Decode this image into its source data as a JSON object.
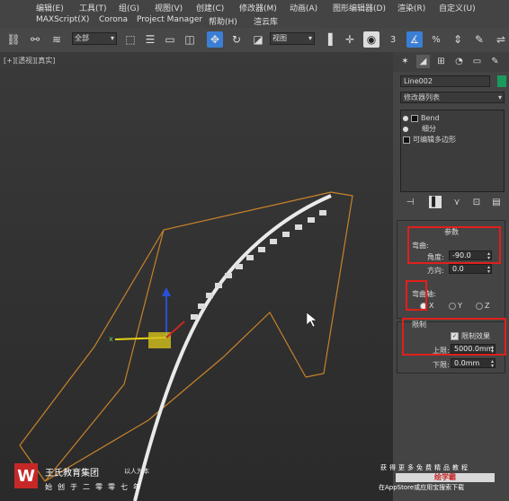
{
  "menubar": {
    "row1": [
      "编辑(E)",
      "工具(T)",
      "组(G)",
      "视图(V)",
      "创建(C)",
      "修改器(M)",
      "动画(A)",
      "图形编辑器(D)",
      "渲染(R)",
      "自定义(U)"
    ],
    "row2": [
      "MAXScript(X)",
      "Corona",
      "Project Manager",
      "帮助(H)",
      "渲云库"
    ]
  },
  "toolbar": {
    "selection_filter": "全部",
    "ref_coord": "视图",
    "snap_label": "3",
    "angle_snap_label": "n"
  },
  "viewport": {
    "label": "[+][透视][真实]"
  },
  "panel": {
    "object_name": "Line002",
    "object_color": "#1b9a5e",
    "modifier_list": "修改器列表",
    "stack": [
      "Bend",
      "细分",
      "可编辑多边形"
    ],
    "params_title": "参数",
    "bend_group": "弯曲:",
    "angle_label": "角度:",
    "angle_value": "-90.0",
    "direction_label": "方向:",
    "direction_value": "0.0",
    "axis_group": "弯曲轴:",
    "axis_options": [
      "X",
      "Y",
      "Z"
    ],
    "axis_selected": "X",
    "limits_title": "限制",
    "limit_effect_label": "限制效果",
    "upper_label": "上限:",
    "upper_value": "5000.0mm",
    "lower_label": "下限:",
    "lower_value": "0.0mm"
  },
  "watermark": {
    "logo": "W",
    "company": "王氏教育集团",
    "slogan": "以人为本",
    "since": "始创于二零零七年",
    "right_line1": "获得更多免费精品教程",
    "badge": "绘学霸",
    "right_line2": "在AppStore或应用宝搜索下载"
  },
  "colors": {
    "highlight": "#e0201b",
    "wireframe": "#c8822a",
    "active_tool": "#3a7fd5"
  }
}
